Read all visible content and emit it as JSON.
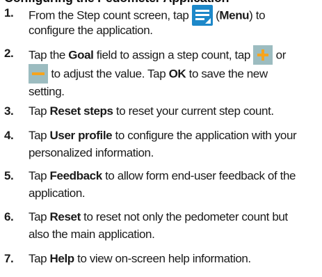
{
  "heading": "Configuring the Pedometer Application",
  "icons": {
    "menu": "menu-icon",
    "plus": "plus-icon",
    "minus": "minus-icon",
    "accent_blue": "#1d88c9",
    "accent_orange": "#f7a41d",
    "button_gray": "#9cbcc0"
  },
  "steps": [
    {
      "num": "1.",
      "t1": "From the Step count screen, tap",
      "t2": "(",
      "b1": "Menu",
      "t3": ") to",
      "l2": "configure the application."
    },
    {
      "num": "2.",
      "t1": "Tap the ",
      "b1": "Goal",
      "t2": " field to assign a step count, tap",
      "t3": "or",
      "l2_t1": "to adjust the value. Tap ",
      "l2_b1": "OK",
      "l2_t2": " to save the new",
      "l3": "setting."
    },
    {
      "num": "3.",
      "t1": "Tap ",
      "b1": "Reset steps",
      "t2": " to reset your current step count."
    },
    {
      "num": "4.",
      "t1": "Tap ",
      "b1": "User profile",
      "t2": " to configure the application with your",
      "l2": "personalized information."
    },
    {
      "num": "5.",
      "t1": "Tap ",
      "b1": "Feedback",
      "t2": " to allow form end-user feedback of the",
      "l2": "application."
    },
    {
      "num": "6.",
      "t1": "Tap ",
      "b1": "Reset",
      "t2": " to reset not only the pedometer count but",
      "l2": "also the main application."
    },
    {
      "num": "7.",
      "t1": "Tap ",
      "b1": "Help",
      "t2": " to view on-screen help information."
    }
  ]
}
